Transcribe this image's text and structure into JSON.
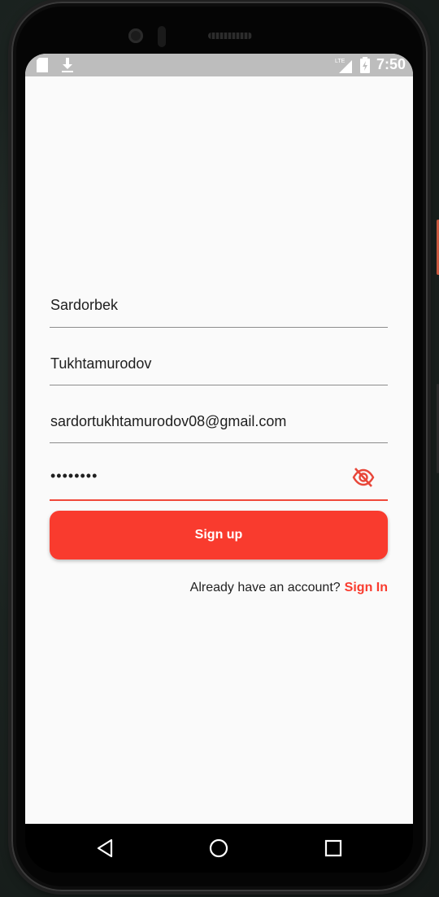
{
  "status_bar": {
    "time": "7:50",
    "icons": [
      "sd-card-icon",
      "download-icon",
      "lte-signal-icon",
      "battery-charging-icon"
    ]
  },
  "form": {
    "first_name": "Sardorbek",
    "last_name": "Tukhtamurodov",
    "email": "sardortukhtamurodov08@gmail.com",
    "password_masked": "••••••••",
    "password_toggle_icon": "eye-off-icon"
  },
  "signup_button": {
    "label": "Sign up"
  },
  "signin_prompt": {
    "text": "Already have an account?",
    "link": "Sign In"
  },
  "colors": {
    "accent": "#f93b2e",
    "background": "#fafafa",
    "status_bar": "#bdbdbd"
  },
  "nav_bar": {
    "buttons": [
      "back-icon",
      "home-icon",
      "recents-icon"
    ]
  }
}
